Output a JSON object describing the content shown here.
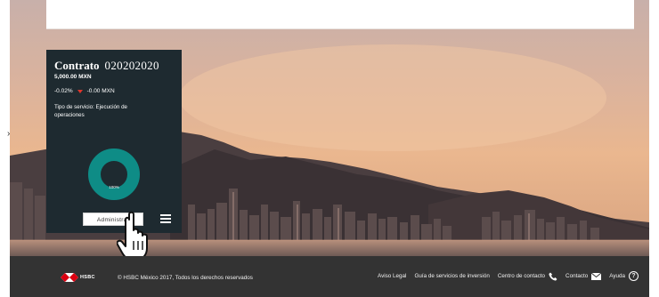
{
  "card": {
    "title": "Contrato",
    "contract_number": "020202020",
    "amount": "5,000.00 MXN",
    "change_percent": "-0.02%",
    "change_amount": "-0.00 MXN",
    "service_text": "Tipo de servicio: Ejecución de operaciones",
    "donut_label": "100%",
    "donut_value": 1.0,
    "donut_color": "#0e8c86",
    "admin_button_label": "Administrar"
  },
  "footer": {
    "brand": "HSBC",
    "copyright": "© HSBC México 2017, Todos los derechos reservados",
    "links": {
      "legal": "Aviso Legal",
      "guide": "Guía de servicios de inversión",
      "contact_center": "Centro de contacto",
      "contact": "Contacto",
      "help": "Ayuda"
    },
    "brand_color": "#db0011"
  }
}
